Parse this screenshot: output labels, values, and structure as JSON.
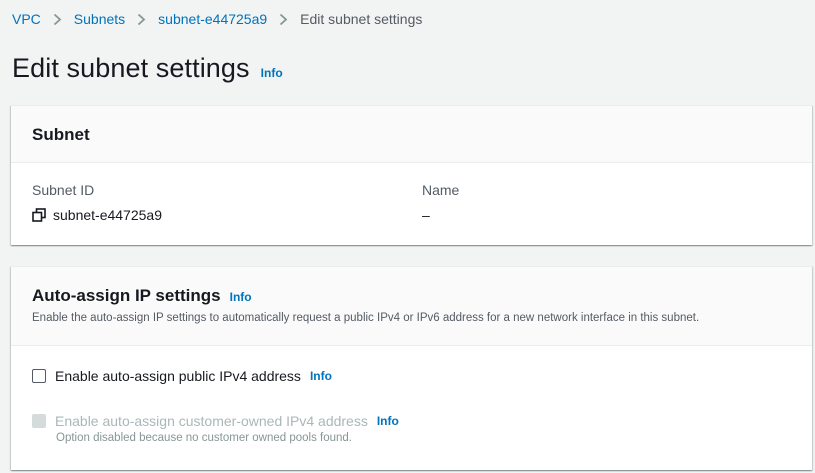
{
  "breadcrumb": {
    "items": [
      {
        "label": "VPC"
      },
      {
        "label": "Subnets"
      },
      {
        "label": "subnet-e44725a9"
      }
    ],
    "current": "Edit subnet settings"
  },
  "page": {
    "title": "Edit subnet settings",
    "info": "Info"
  },
  "subnet_panel": {
    "heading": "Subnet",
    "subnet_id_label": "Subnet ID",
    "subnet_id_value": "subnet-e44725a9",
    "name_label": "Name",
    "name_value": "–"
  },
  "auto_assign_panel": {
    "heading": "Auto-assign IP settings",
    "info": "Info",
    "description": "Enable the auto-assign IP settings to automatically request a public IPv4 or IPv6 address for a new network interface in this subnet.",
    "ipv4_checkbox": {
      "label": "Enable auto-assign public IPv4 address",
      "info": "Info",
      "checked": false
    },
    "customer_owned_checkbox": {
      "label": "Enable auto-assign customer-owned IPv4 address",
      "info": "Info",
      "checked": false,
      "disabled": true,
      "hint": "Option disabled because no customer owned pools found."
    }
  },
  "colors": {
    "link": "#0073bb",
    "text": "#16191f",
    "secondary_text": "#545b64",
    "background": "#f2f3f3",
    "disabled_text": "#aab7b8"
  },
  "icons": {
    "separator": "chevron-right-icon",
    "copy": "copy-icon"
  }
}
